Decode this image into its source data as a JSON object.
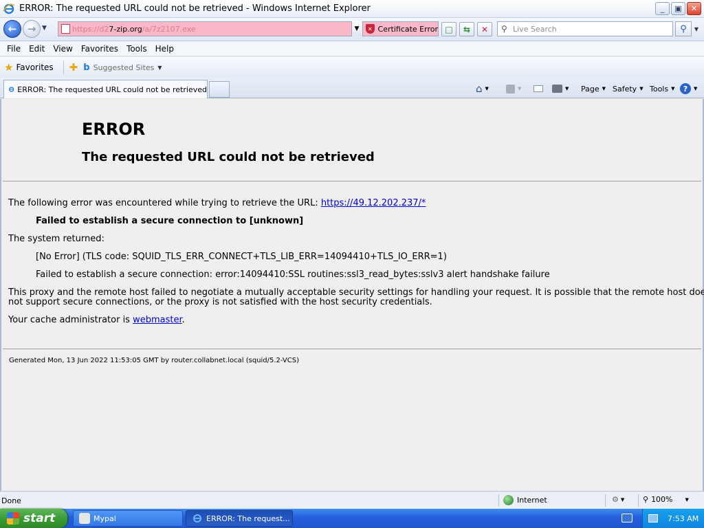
{
  "window": {
    "title": "ERROR: The requested URL could not be retrieved - Windows Internet Explorer",
    "minimize": "_",
    "maximize": "▣",
    "close": "✕"
  },
  "address_bar": {
    "prefix": "https://d2",
    "host": "7-zip.org",
    "suffix": "/a/7z2107.exe",
    "cert_error": "Certificate Error",
    "search_placeholder": "Live Search"
  },
  "menu": [
    "File",
    "Edit",
    "View",
    "Favorites",
    "Tools",
    "Help"
  ],
  "favorites_bar": {
    "favorites_label": "Favorites",
    "suggested_sites": "Suggested Sites"
  },
  "tab": {
    "title": "ERROR: The requested URL could not be retrieved"
  },
  "command_bar": {
    "page": "Page",
    "safety": "Safety",
    "tools": "Tools"
  },
  "page": {
    "heading": "ERROR",
    "subheading": "The requested URL could not be retrieved",
    "intro": "The following error was encountered while trying to retrieve the URL: ",
    "url": "https://49.12.202.237/*",
    "failed_bold": "Failed to establish a secure connection to [unknown]",
    "system_returned": "The system returned:",
    "tls_code": "[No Error] (TLS code: SQUID_TLS_ERR_CONNECT+TLS_LIB_ERR=14094410+TLS_IO_ERR=1)",
    "ssl_error": "Failed to establish a secure connection: error:14094410:SSL routines:ssl3_read_bytes:sslv3 alert handshake failure",
    "explanation_1": "This proxy and the remote host failed to negotiate a mutually acceptable security settings for handling your request. It is possible that the remote host does",
    "explanation_2": "not support secure connections, or the proxy is not satisfied with the host security credentials.",
    "admin_prefix": "Your cache administrator is ",
    "admin_link": "webmaster",
    "admin_suffix": ".",
    "generated": "Generated Mon, 13 Jun 2022 11:53:05 GMT by router.collabnet.local (squid/5.2-VCS)"
  },
  "status_bar": {
    "status": "Done",
    "zone": "Internet",
    "zoom": "100%"
  },
  "taskbar": {
    "start": "start",
    "items": [
      "Mypal",
      "ERROR: The request..."
    ],
    "clock": "7:53 AM"
  },
  "colors": {
    "address_error_bg": "#f9b8c8",
    "link": "#0000cc",
    "taskbar": "#245edb",
    "start_button": "#3a9b35"
  }
}
